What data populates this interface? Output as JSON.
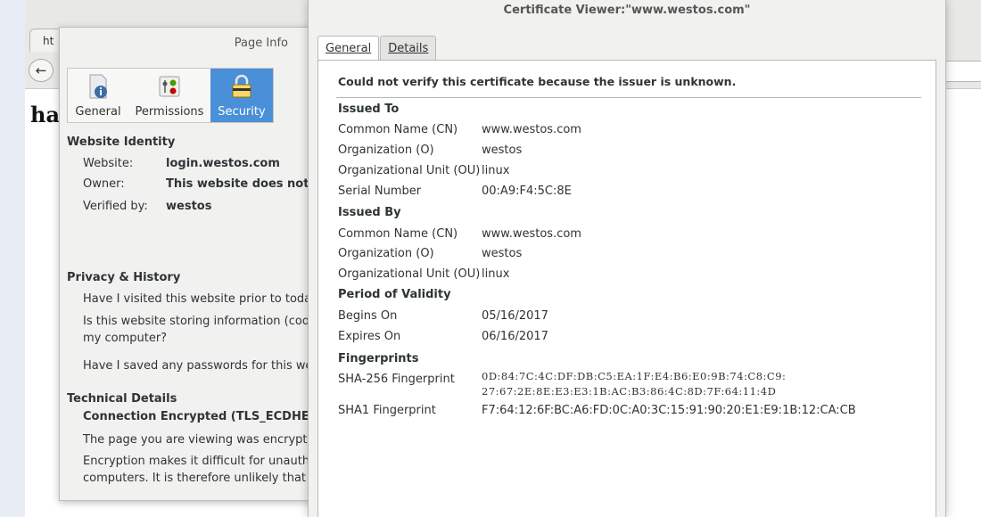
{
  "browser": {
    "tab_label": "ht",
    "back_icon": "arrow-left-icon",
    "page_heading_fragment": "ha"
  },
  "page_info": {
    "title": "Page Info",
    "tabs": [
      {
        "label": "General",
        "icon": "info-page-icon"
      },
      {
        "label": "Permissions",
        "icon": "permissions-icon"
      },
      {
        "label": "Security",
        "icon": "lock-icon"
      }
    ],
    "active_tab": "Security",
    "website_identity": {
      "header": "Website Identity",
      "website_label": "Website:",
      "website_value": "login.westos.com",
      "owner_label": "Owner:",
      "owner_value": "This website does not su",
      "verified_label": "Verified by:",
      "verified_value": "westos"
    },
    "privacy": {
      "header": "Privacy & History",
      "q1": "Have I visited this website prior to toda",
      "q2_line1": "Is this website storing information (cool",
      "q2_line2": "my computer?",
      "q3": "Have I saved any passwords for this we"
    },
    "technical": {
      "header": "Technical Details",
      "connection": "Connection Encrypted (TLS_ECDHE_R",
      "line1": "The page you are viewing was encrypte",
      "line2": "Encryption makes it difficult for unautho",
      "line3": "computers. It is therefore unlikely that"
    }
  },
  "cert_viewer": {
    "title": "Certificate Viewer:\"www.westos.com\"",
    "tabs": [
      {
        "label": "General",
        "active": true
      },
      {
        "label": "Details",
        "active": false
      }
    ],
    "warning": "Could not verify this certificate because the issuer is unknown.",
    "issued_to": {
      "header": "Issued To",
      "cn_label": "Common Name (CN)",
      "cn_value": "www.westos.com",
      "o_label": "Organization (O)",
      "o_value": "westos",
      "ou_label": "Organizational Unit (OU)",
      "ou_value": "linux",
      "serial_label": "Serial Number",
      "serial_value": "00:A9:F4:5C:8E"
    },
    "issued_by": {
      "header": "Issued By",
      "cn_label": "Common Name (CN)",
      "cn_value": "www.westos.com",
      "o_label": "Organization (O)",
      "o_value": "westos",
      "ou_label": "Organizational Unit (OU)",
      "ou_value": "linux"
    },
    "validity": {
      "header": "Period of Validity",
      "begins_label": "Begins On",
      "begins_value": "05/16/2017",
      "expires_label": "Expires On",
      "expires_value": "06/16/2017"
    },
    "fingerprints": {
      "header": "Fingerprints",
      "sha256_label": "SHA-256 Fingerprint",
      "sha256_line1": "0D:84:7C:4C:DF:DB:C5:EA:1F:E4:B6:E0:9B:74:C8:C9:",
      "sha256_line2": "27:67:2E:8E:E3:E3:1B:AC:B3:86:4C:8D:7F:64:11:4D",
      "sha1_label": "SHA1 Fingerprint",
      "sha1_value": "F7:64:12:6F:BC:A6:FD:0C:A0:3C:15:91:90:20:E1:E9:1B:12:CA:CB"
    }
  },
  "colors": {
    "active_tab_bg": "#4a90d9",
    "window_bg": "#f1f1f0",
    "panel_bg": "#ffffff"
  }
}
